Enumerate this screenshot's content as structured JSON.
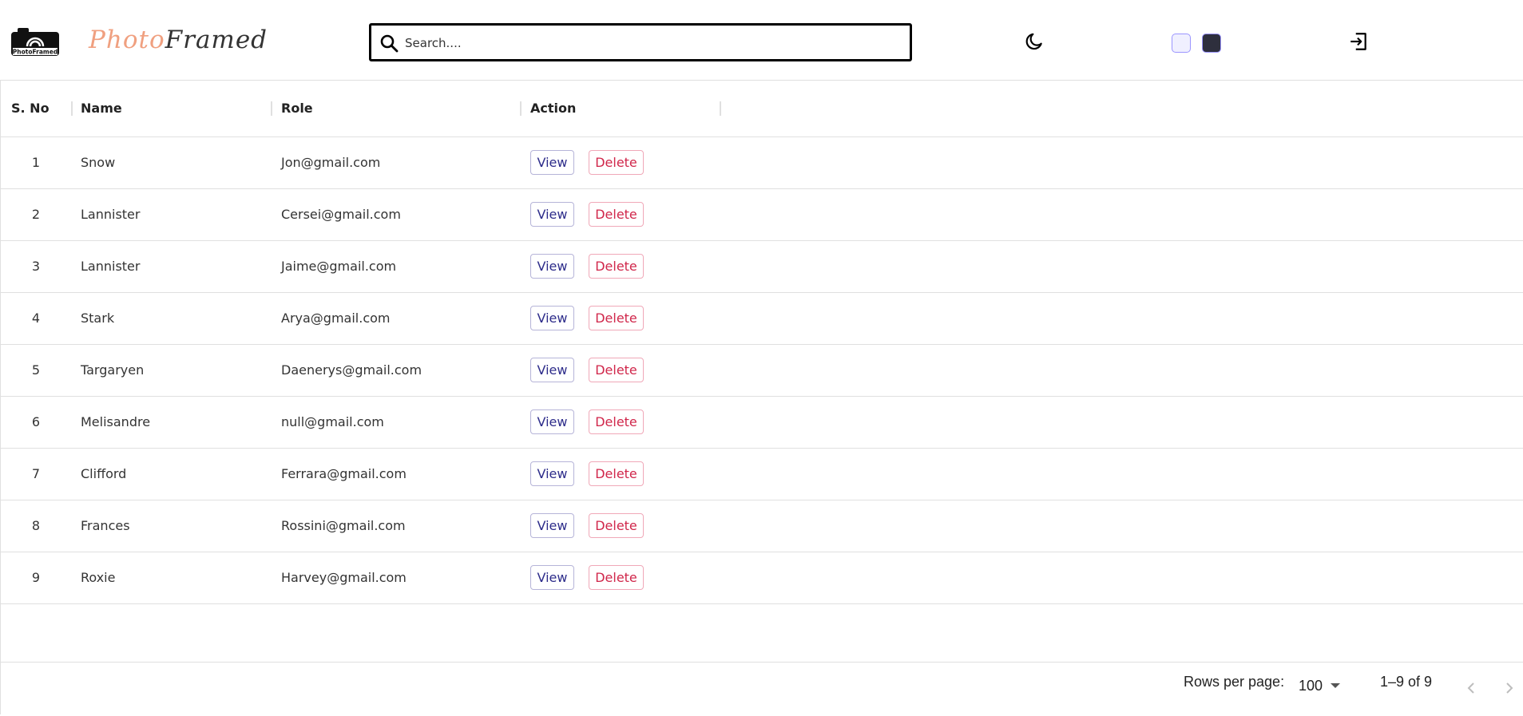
{
  "header": {
    "logo_text": "PhotoFramed",
    "brand_part1": "Photo",
    "brand_part2": "Framed",
    "search_placeholder": "Search....",
    "icons": {
      "search": "search-icon",
      "theme": "moon-icon",
      "logout": "logout-icon"
    },
    "theme_swatches": [
      {
        "name": "light",
        "color": "#f0f0ff"
      },
      {
        "name": "dark",
        "color": "#2e2f3d"
      }
    ]
  },
  "table": {
    "headers": {
      "sno": "S. No",
      "name": "Name",
      "role": "Role",
      "action": "Action"
    },
    "rows": [
      {
        "sno": "1",
        "name": "Snow",
        "role": "Jon@gmail.com"
      },
      {
        "sno": "2",
        "name": "Lannister",
        "role": "Cersei@gmail.com"
      },
      {
        "sno": "3",
        "name": "Lannister",
        "role": "Jaime@gmail.com"
      },
      {
        "sno": "4",
        "name": "Stark",
        "role": "Arya@gmail.com"
      },
      {
        "sno": "5",
        "name": "Targaryen",
        "role": "Daenerys@gmail.com"
      },
      {
        "sno": "6",
        "name": "Melisandre",
        "role": "null@gmail.com"
      },
      {
        "sno": "7",
        "name": "Clifford",
        "role": "Ferrara@gmail.com"
      },
      {
        "sno": "8",
        "name": "Frances",
        "role": "Rossini@gmail.com"
      },
      {
        "sno": "9",
        "name": "Roxie",
        "role": "Harvey@gmail.com"
      }
    ],
    "view_label": "View",
    "delete_label": "Delete"
  },
  "footer": {
    "rows_per_page_label": "Rows per page:",
    "rows_per_page_value": "100",
    "page_info": "1–9 of 9",
    "icons": {
      "prev": "chevron-left-icon",
      "next": "chevron-right-icon"
    }
  },
  "colors": {
    "view": "#2d2c8a",
    "delete": "#d0264a",
    "brand_accent": "#f0a080"
  }
}
